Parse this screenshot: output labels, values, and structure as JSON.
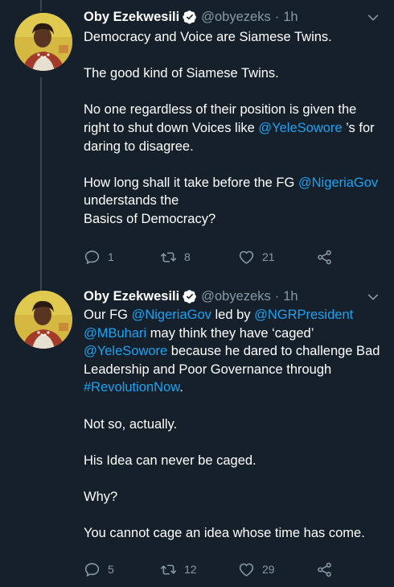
{
  "colors": {
    "background": "#15202b",
    "text": "#ffffff",
    "muted": "#8899a6",
    "link": "#1da1f2",
    "verified": "#ffffff"
  },
  "tweets": [
    {
      "name": "Oby Ezekwesili",
      "handle": "@obyezeks",
      "separator": "·",
      "time": "1h",
      "paragraphs": [
        [
          {
            "t": "Democracy and Voice are Siamese Twins."
          }
        ],
        [
          {
            "t": "The good kind of Siamese Twins."
          }
        ],
        [
          {
            "t": "No one regardless of their position is given the right to shut down Voices like "
          },
          {
            "t": "@YeleSowore",
            "link": true
          },
          {
            "t": " ’s for daring to disagree."
          }
        ],
        [
          {
            "t": "How long shall it take before the FG "
          },
          {
            "t": "@NigeriaGov",
            "link": true
          },
          {
            "t": "\nunderstands the\nBasics of Democracy?"
          }
        ]
      ],
      "replies": "1",
      "retweets": "8",
      "likes": "21"
    },
    {
      "name": "Oby Ezekwesili",
      "handle": "@obyezeks",
      "separator": "·",
      "time": "1h",
      "paragraphs": [
        [
          {
            "t": "Our FG "
          },
          {
            "t": "@NigeriaGov",
            "link": true
          },
          {
            "t": " led by "
          },
          {
            "t": "@NGRPresident",
            "link": true
          },
          {
            "t": "\n"
          },
          {
            "t": "@MBuhari",
            "link": true
          },
          {
            "t": " may think they have ‘caged’\n"
          },
          {
            "t": "@YeleSowore",
            "link": true
          },
          {
            "t": " because he dared to challenge Bad Leadership and Poor Governance through\n"
          },
          {
            "t": "#RevolutionNow",
            "link": true
          },
          {
            "t": "."
          }
        ],
        [
          {
            "t": "Not so, actually."
          }
        ],
        [
          {
            "t": "His Idea can never be caged."
          }
        ],
        [
          {
            "t": "Why?"
          }
        ],
        [
          {
            "t": "You cannot cage an idea whose time has come."
          }
        ]
      ],
      "replies": "5",
      "retweets": "12",
      "likes": "29"
    }
  ]
}
